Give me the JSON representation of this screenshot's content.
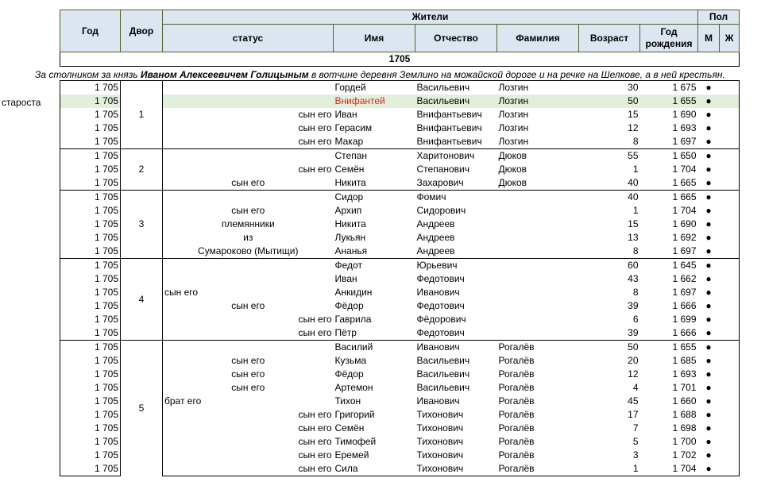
{
  "header": {
    "year": "Год",
    "dvor": "Двор",
    "residents": "Жители",
    "sex": "Пол",
    "status": "статус",
    "name": "Имя",
    "patronymic": "Отчество",
    "surname": "Фамилия",
    "age": "Возраст",
    "birth_year": "Год рождения",
    "male": "М",
    "female": "Ж"
  },
  "year_banner": "1705",
  "caption": {
    "prefix": "За столником за князь ",
    "owner": "Иваном Алексеевичем Голицыным",
    "suffix": " в вотчине деревня Землино на можайской дороге и на речке на Шелкове, а в ней крестьян."
  },
  "side_label": "староста",
  "male_mark": "●",
  "dvor_labels": [
    "1",
    "2",
    "3",
    "4",
    "5"
  ],
  "rows": [
    {
      "year": "1 705",
      "status": "",
      "name": "Гордей",
      "patronymic": "Васильевич",
      "surname": "Лозгин",
      "age": "30",
      "birth": "1 675"
    },
    {
      "year": "1 705",
      "status": "",
      "name": "Внифантей",
      "patronymic": "Васильевич",
      "surname": "Лозгин",
      "age": "50",
      "birth": "1 655"
    },
    {
      "year": "1 705",
      "status": "сын его",
      "name": "Иван",
      "patronymic": "Внифантьевич",
      "surname": "Лозгин",
      "age": "15",
      "birth": "1 690"
    },
    {
      "year": "1 705",
      "status": "сын его",
      "name": "Герасим",
      "patronymic": "Внифантьевич",
      "surname": "Лозгин",
      "age": "12",
      "birth": "1 693"
    },
    {
      "year": "1 705",
      "status": "сын его",
      "name": "Макар",
      "patronymic": "Внифантьевич",
      "surname": "Лозгин",
      "age": "8",
      "birth": "1 697"
    },
    {
      "year": "1 705",
      "status": "",
      "name": "Степан",
      "patronymic": "Харитонович",
      "surname": "Дюков",
      "age": "55",
      "birth": "1 650"
    },
    {
      "year": "1 705",
      "status": "сын его",
      "name": "Семён",
      "patronymic": "Степанович",
      "surname": "Дюков",
      "age": "1",
      "birth": "1 704"
    },
    {
      "year": "1 705",
      "status": "сын его",
      "name": "Никита",
      "patronymic": "Захарович",
      "surname": "Дюков",
      "age": "40",
      "birth": "1 665"
    },
    {
      "year": "1 705",
      "status": "",
      "name": "Сидор",
      "patronymic": "Фомич",
      "surname": "",
      "age": "40",
      "birth": "1 665"
    },
    {
      "year": "1 705",
      "status": "сын его",
      "name": "Архип",
      "patronymic": "Сидорович",
      "surname": "",
      "age": "1",
      "birth": "1 704"
    },
    {
      "year": "1 705",
      "status": "племянники",
      "name": "Никита",
      "patronymic": "Андреев",
      "surname": "",
      "age": "15",
      "birth": "1 690"
    },
    {
      "year": "1 705",
      "status": "из",
      "name": "Лукьян",
      "patronymic": "Андреев",
      "surname": "",
      "age": "13",
      "birth": "1 692"
    },
    {
      "year": "1 705",
      "status": "Сумароково (Мытищи)",
      "name": "Ананья",
      "patronymic": "Андреев",
      "surname": "",
      "age": "8",
      "birth": "1 697"
    },
    {
      "year": "1 705",
      "status": "",
      "name": "Федот",
      "patronymic": "Юрьевич",
      "surname": "",
      "age": "60",
      "birth": "1 645"
    },
    {
      "year": "1 705",
      "status": "",
      "name": "Иван",
      "patronymic": "Федотович",
      "surname": "",
      "age": "43",
      "birth": "1 662"
    },
    {
      "year": "1 705",
      "status": "сын его",
      "name": "Анкидин",
      "patronymic": "Иванович",
      "surname": "",
      "age": "8",
      "birth": "1 697"
    },
    {
      "year": "1 705",
      "status": "сын его",
      "name": "Фёдор",
      "patronymic": "Федотович",
      "surname": "",
      "age": "39",
      "birth": "1 666"
    },
    {
      "year": "1 705",
      "status": "сын его",
      "name": "Гаврила",
      "patronymic": "Фёдорович",
      "surname": "",
      "age": "6",
      "birth": "1 699"
    },
    {
      "year": "1 705",
      "status": "сын его",
      "name": "Пётр",
      "patronymic": "Федотович",
      "surname": "",
      "age": "39",
      "birth": "1 666"
    },
    {
      "year": "1 705",
      "status": "",
      "name": "Василий",
      "patronymic": "Иванович",
      "surname": "Рогалёв",
      "age": "50",
      "birth": "1 655"
    },
    {
      "year": "1 705",
      "status": "сын его",
      "name": "Кузьма",
      "patronymic": "Васильевич",
      "surname": "Рогалёв",
      "age": "20",
      "birth": "1 685"
    },
    {
      "year": "1 705",
      "status": "сын его",
      "name": "Фёдор",
      "patronymic": "Васильевич",
      "surname": "Рогалёв",
      "age": "12",
      "birth": "1 693"
    },
    {
      "year": "1 705",
      "status": "сын его",
      "name": "Артемон",
      "patronymic": "Васильевич",
      "surname": "Рогалёв",
      "age": "4",
      "birth": "1 701"
    },
    {
      "year": "1 705",
      "status": "брат его",
      "name": "Тихон",
      "patronymic": "Иванович",
      "surname": "Рогалёв",
      "age": "45",
      "birth": "1 660"
    },
    {
      "year": "1 705",
      "status": "сын его",
      "name": "Григорий",
      "patronymic": "Тихонович",
      "surname": "Рогалёв",
      "age": "17",
      "birth": "1 688"
    },
    {
      "year": "1 705",
      "status": "сын его",
      "name": "Семён",
      "patronymic": "Тихонович",
      "surname": "Рогалёв",
      "age": "7",
      "birth": "1 698"
    },
    {
      "year": "1 705",
      "status": "сын его",
      "name": "Тимофей",
      "patronymic": "Тихонович",
      "surname": "Рогалёв",
      "age": "5",
      "birth": "1 700"
    },
    {
      "year": "1 705",
      "status": "сын его",
      "name": "Еремей",
      "patronymic": "Тихонович",
      "surname": "Рогалёв",
      "age": "3",
      "birth": "1 702"
    },
    {
      "year": "1 705",
      "status": "сын его",
      "name": "Сила",
      "patronymic": "Тихонович",
      "surname": "Рогалёв",
      "age": "1",
      "birth": "1 704"
    }
  ]
}
